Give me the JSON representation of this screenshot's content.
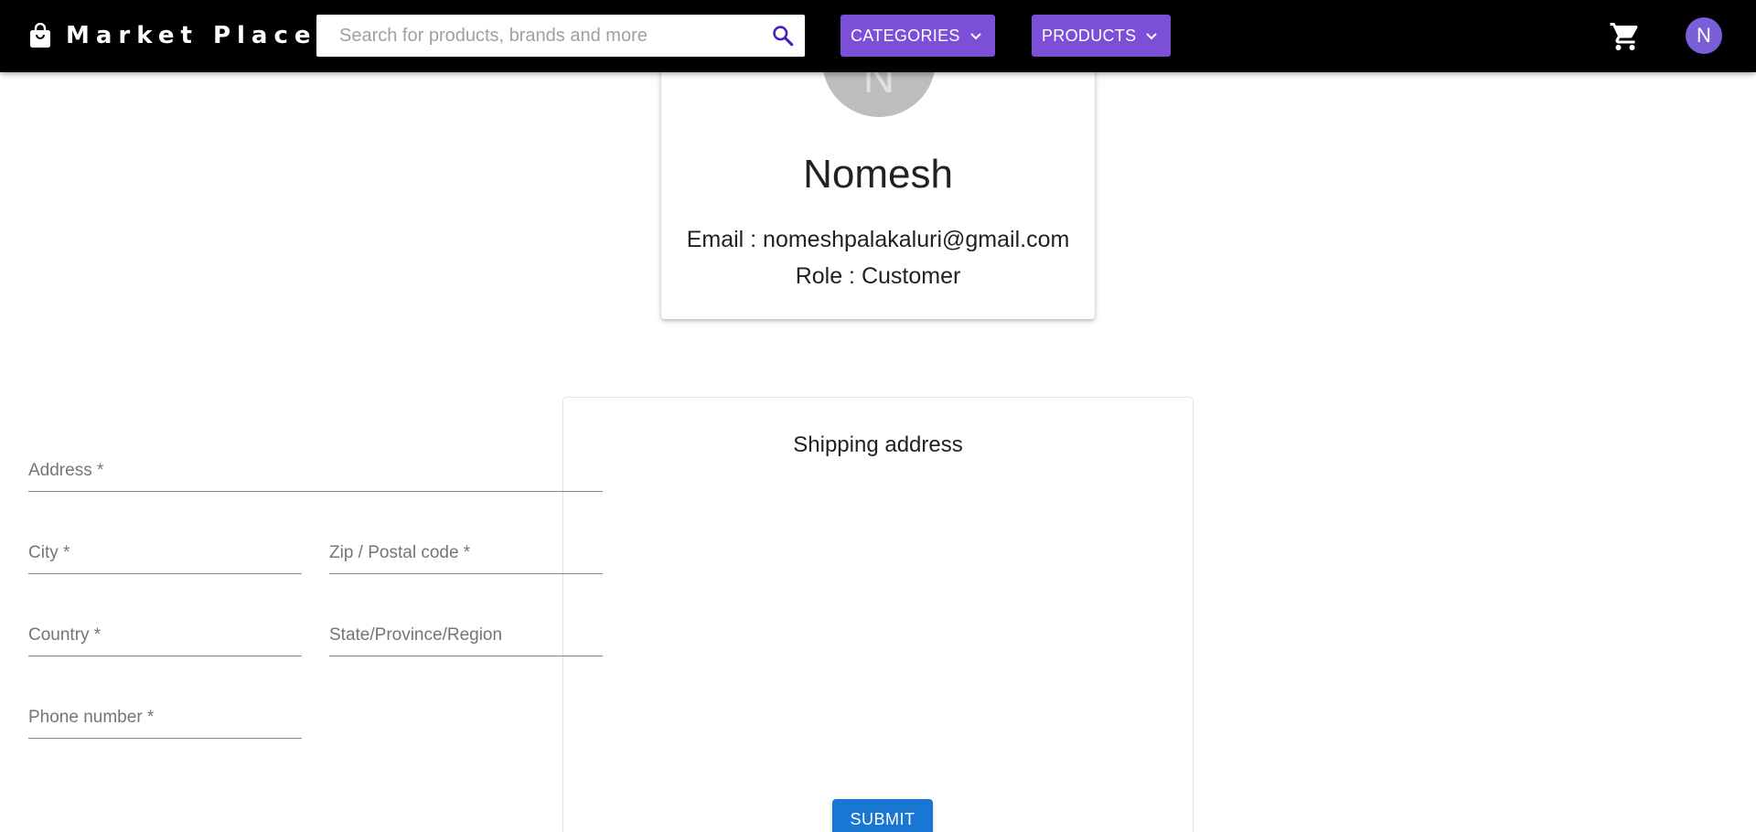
{
  "header": {
    "brand": "Market Place",
    "brand_icon": "shopping-bag-icon",
    "search_placeholder": "Search for products, brands and more",
    "search_icon": "search-icon",
    "categories_label": "CATEGORIES",
    "products_label": "PRODUCTS",
    "cart_icon": "cart-icon",
    "avatar_initial": "N"
  },
  "profile": {
    "avatar_initial": "N",
    "name": "Nomesh",
    "email_line": "Email : nomeshpalakaluri@gmail.com",
    "role_line": "Role : Customer"
  },
  "shipping": {
    "title": "Shipping address",
    "fields": {
      "address": "Address *",
      "city": "City *",
      "zip": "Zip / Postal code *",
      "country": "Country *",
      "state": "State/Province/Region",
      "phone": "Phone number *"
    },
    "submit_label": "SUBMIT"
  },
  "colors": {
    "topbar": "#000000",
    "menu_button": "#7b4fd8",
    "avatar": "#7b5fd9",
    "submit": "#1976d2",
    "profile_avatar": "#bdbdbd"
  }
}
